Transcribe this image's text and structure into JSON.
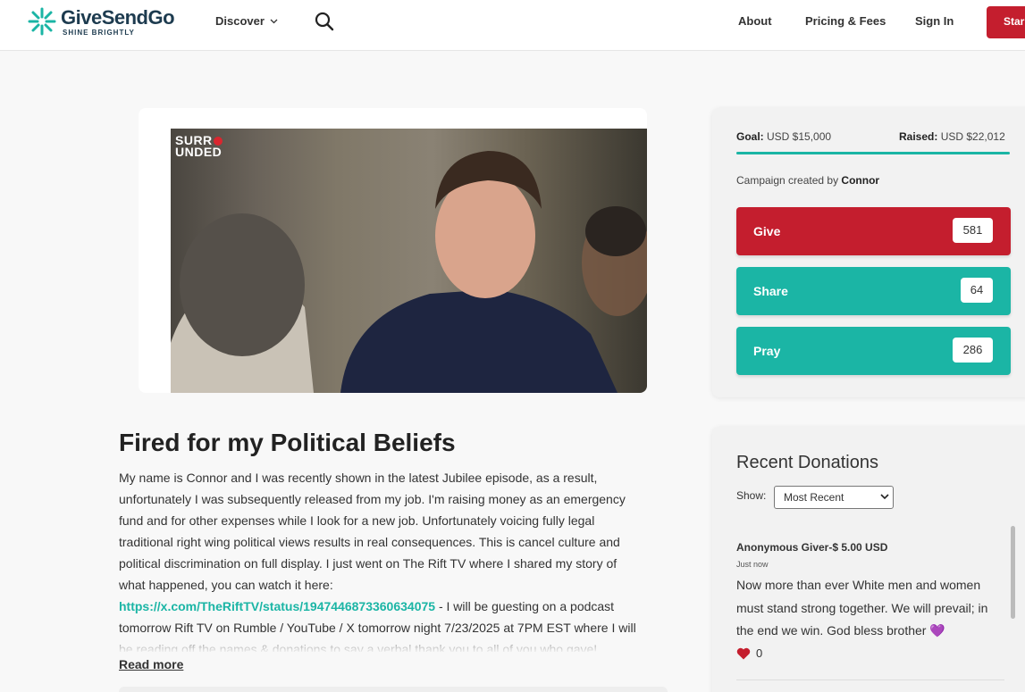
{
  "header": {
    "brand_name": "GiveSendGo",
    "brand_tagline": "SHINE BRIGHTLY",
    "discover_label": "Discover",
    "about_label": "About",
    "pricing_label": "Pricing & Fees",
    "signin_label": "Sign In",
    "start_label": "Star"
  },
  "media": {
    "video_logo_line1": "SURR",
    "video_logo_line2": "UNDED"
  },
  "story": {
    "title": "Fired for my Political Beliefs",
    "body_before_link": "My name is Connor and I was recently shown in the latest Jubilee episode, as a result, unfortunately I was subsequently released from my job. I'm raising money as an emergency fund and for other expenses while I look for a new job. Unfortunately voicing fully legal traditional right wing political views results in real consequences. This is cancel culture and political discrimination on full display. I just went on The Rift TV where I shared my story of what happened, you can watch it here: ",
    "link": "https://x.com/TheRiftTV/status/1947446873360634075",
    "body_after_link": " - I will be guesting on a podcast tomorrow Rift TV on Rumble / YouTube / X tomorrow night 7/23/2025 at 7PM EST where I will be reading off the names & donations to say a verbal thank you to all of you who gave!",
    "read_more": "Read more"
  },
  "campaign": {
    "goal_label": "Goal:",
    "goal_value": "USD $15,000",
    "raised_label": "Raised:",
    "raised_value": "USD $22,012",
    "progress_fraction": 1.0,
    "created_prefix": "Campaign created by",
    "creator": "Connor",
    "give_label": "Give",
    "give_count": "581",
    "share_label": "Share",
    "share_count": "64",
    "pray_label": "Pray",
    "pray_count": "286"
  },
  "donations": {
    "title": "Recent Donations",
    "show_label": "Show:",
    "filter_selected": "Most Recent",
    "items": [
      {
        "donor": "Anonymous Giver",
        "amount": "-$ 5.00 USD",
        "time": "Just now",
        "message": "Now more than ever White men and women must stand strong together. We will prevail; in the end we win. God bless brother 💜",
        "likes": "0"
      }
    ]
  },
  "colors": {
    "brand_teal": "#1bb5a5",
    "brand_red": "#c41e2e",
    "brand_navy": "#1d3b4f"
  }
}
